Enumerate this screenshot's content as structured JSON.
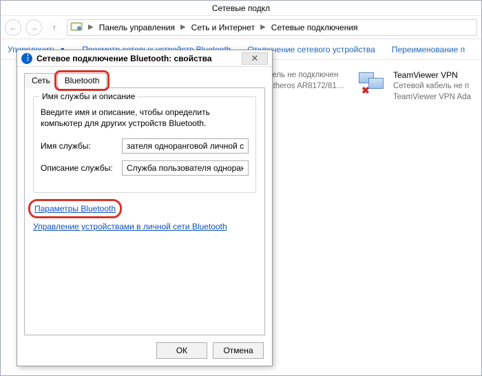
{
  "window": {
    "title": "Сетевые подкл"
  },
  "breadcrumb": {
    "root_icon": "control-panel-icon",
    "items": [
      "Панель управления",
      "Сеть и Интернет",
      "Сетевые подключения"
    ]
  },
  "toolbar": {
    "organize": "Упорядочить",
    "view_bt": "Просмотр сетевых устройств Bluetooth",
    "disable": "Отключение сетевого устройства",
    "rename": "Переименование п"
  },
  "connections": {
    "mid": {
      "status": "бель не подключен",
      "adapter": "Atheros AR8172/81…"
    },
    "right": {
      "name": "TeamViewer VPN",
      "status": "Сетевой кабель не п",
      "adapter": "TeamViewer VPN Ada"
    }
  },
  "dialog": {
    "title": "Сетевое подключение Bluetooth: свойства",
    "tabs": {
      "net": "Сеть",
      "bt": "Bluetooth"
    },
    "group": {
      "legend": "Имя службы и описание",
      "desc": "Введите имя и описание, чтобы определить компьютер для других устройств Bluetooth.",
      "name_label": "Имя службы:",
      "name_value": "зателя одноранговой личной сети",
      "desc_label": "Описание службы:",
      "desc_value": "Служба пользователя одноранговой"
    },
    "link_params": "Параметры Bluetooth",
    "link_manage": "Управление устройствами в личной сети Bluetooth",
    "ok": "ОК",
    "cancel": "Отмена"
  }
}
